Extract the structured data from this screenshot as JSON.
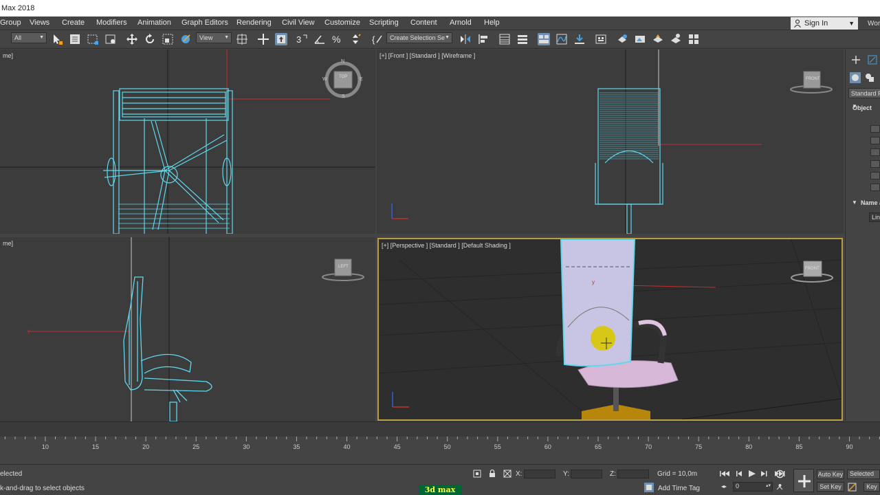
{
  "window": {
    "title": "Max 2018"
  },
  "menu": {
    "items": [
      "Group",
      "Views",
      "Create",
      "Modifiers",
      "Animation",
      "Graph Editors",
      "Rendering",
      "Civil View",
      "Customize",
      "Scripting",
      "Content",
      "Arnold",
      "Help"
    ],
    "sign_in": "Sign In",
    "workspace": "Work"
  },
  "toolbar": {
    "filter": "All",
    "coord": "View",
    "selection_set": "Create Selection Se"
  },
  "viewports": {
    "top": {
      "label": "me]"
    },
    "front": {
      "label": "[+] [Front ] [Standard ] [Wireframe ]"
    },
    "left": {
      "label": "me]"
    },
    "perspective": {
      "label": "[+] [Perspective ] [Standard ] [Default Shading ]"
    },
    "viewcube": {
      "top": "TOP",
      "left": "LEFT",
      "front": "FRONT",
      "n": "N",
      "s": "S",
      "e": "E",
      "w": "W"
    },
    "axis": {
      "x": "x",
      "y": "y",
      "z": "z"
    }
  },
  "command_panel": {
    "standard": "Standard P",
    "object_type": "Object",
    "name_color": "Name a",
    "line": "Line"
  },
  "timeline": {
    "ticks": [
      "10",
      "15",
      "20",
      "25",
      "30",
      "35",
      "40",
      "45",
      "50",
      "55",
      "60",
      "65",
      "70",
      "75",
      "80",
      "85",
      "90"
    ]
  },
  "status": {
    "selected": "elected",
    "prompt": "k-and-drag to select objects",
    "x_label": "X:",
    "y_label": "Y:",
    "z_label": "Z:",
    "grid": "Grid = 10,0m",
    "add_time_tag": "Add Time Tag",
    "auto_key": "Auto Key",
    "set_key": "Set Key",
    "selected_dropdown": "Selected",
    "key_filters": "Key",
    "frame": "0",
    "brand": "3d max"
  }
}
